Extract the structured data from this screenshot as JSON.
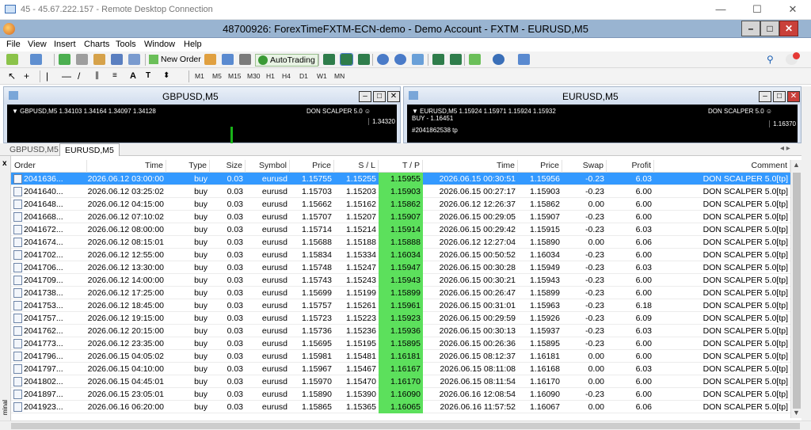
{
  "rdp": {
    "title": "45 - 45.67.222.157 - Remote Desktop Connection",
    "min": "—",
    "max": "☐",
    "close": "✕"
  },
  "app": {
    "title": "48700926: ForexTimeFXTM-ECN-demo - Demo Account - FXTM - EURUSD,M5"
  },
  "menu": [
    "File",
    "View",
    "Insert",
    "Charts",
    "Tools",
    "Window",
    "Help"
  ],
  "toolbar": {
    "new_order": "New Order",
    "auto_trading": "AutoTrading"
  },
  "timeframes": [
    "M1",
    "M5",
    "M15",
    "M30",
    "H1",
    "H4",
    "D1",
    "W1",
    "MN"
  ],
  "charts": [
    {
      "name": "GBPUSD,M5",
      "info": "GBPUSD,M5  1.34103 1.34164 1.34097 1.34128",
      "ea": "DON SCALPER 5.0",
      "price": "1.34320",
      "extra": "",
      "note": ""
    },
    {
      "name": "EURUSD,M5",
      "info": "EURUSD,M5  1.15924 1.15971 1.15924 1.15932",
      "ea": "DON SCALPER 5.0",
      "price": "1.16370",
      "extra": "BUY - 1.16451",
      "note": "#2041862538 tp"
    }
  ],
  "chart_tabs": [
    "GBPUSD,M5",
    "EURUSD,M5"
  ],
  "terminal": {
    "label": "minal",
    "close": "x",
    "columns": [
      "Order",
      "Time",
      "Type",
      "Size",
      "Symbol",
      "Price",
      "S / L",
      "T / P",
      "Time",
      "Price",
      "Swap",
      "Profit",
      "Comment"
    ],
    "rows": [
      [
        "2041636...",
        "2026.06.12 03:00:00",
        "buy",
        "0.03",
        "eurusd",
        "1.15755",
        "1.15255",
        "1.15955",
        "2026.06.15 00:30:51",
        "1.15956",
        "-0.23",
        "6.03",
        "DON SCALPER 5.0[tp]"
      ],
      [
        "2041640...",
        "2026.06.12 03:25:02",
        "buy",
        "0.03",
        "eurusd",
        "1.15703",
        "1.15203",
        "1.15903",
        "2026.06.15 00:27:17",
        "1.15903",
        "-0.23",
        "6.00",
        "DON SCALPER 5.0[tp]"
      ],
      [
        "2041648...",
        "2026.06.12 04:15:00",
        "buy",
        "0.03",
        "eurusd",
        "1.15662",
        "1.15162",
        "1.15862",
        "2026.06.12 12:26:37",
        "1.15862",
        "0.00",
        "6.00",
        "DON SCALPER 5.0[tp]"
      ],
      [
        "2041668...",
        "2026.06.12 07:10:02",
        "buy",
        "0.03",
        "eurusd",
        "1.15707",
        "1.15207",
        "1.15907",
        "2026.06.15 00:29:05",
        "1.15907",
        "-0.23",
        "6.00",
        "DON SCALPER 5.0[tp]"
      ],
      [
        "2041672...",
        "2026.06.12 08:00:00",
        "buy",
        "0.03",
        "eurusd",
        "1.15714",
        "1.15214",
        "1.15914",
        "2026.06.15 00:29:42",
        "1.15915",
        "-0.23",
        "6.03",
        "DON SCALPER 5.0[tp]"
      ],
      [
        "2041674...",
        "2026.06.12 08:15:01",
        "buy",
        "0.03",
        "eurusd",
        "1.15688",
        "1.15188",
        "1.15888",
        "2026.06.12 12:27:04",
        "1.15890",
        "0.00",
        "6.06",
        "DON SCALPER 5.0[tp]"
      ],
      [
        "2041702...",
        "2026.06.12 12:55:00",
        "buy",
        "0.03",
        "eurusd",
        "1.15834",
        "1.15334",
        "1.16034",
        "2026.06.15 00:50:52",
        "1.16034",
        "-0.23",
        "6.00",
        "DON SCALPER 5.0[tp]"
      ],
      [
        "2041706...",
        "2026.06.12 13:30:00",
        "buy",
        "0.03",
        "eurusd",
        "1.15748",
        "1.15247",
        "1.15947",
        "2026.06.15 00:30:28",
        "1.15949",
        "-0.23",
        "6.03",
        "DON SCALPER 5.0[tp]"
      ],
      [
        "2041709...",
        "2026.06.12 14:00:00",
        "buy",
        "0.03",
        "eurusd",
        "1.15743",
        "1.15243",
        "1.15943",
        "2026.06.15 00:30:21",
        "1.15943",
        "-0.23",
        "6.00",
        "DON SCALPER 5.0[tp]"
      ],
      [
        "2041738...",
        "2026.06.12 17:25:00",
        "buy",
        "0.03",
        "eurusd",
        "1.15699",
        "1.15199",
        "1.15899",
        "2026.06.15 00:26:47",
        "1.15899",
        "-0.23",
        "6.00",
        "DON SCALPER 5.0[tp]"
      ],
      [
        "2041753...",
        "2026.06.12 18:45:00",
        "buy",
        "0.03",
        "eurusd",
        "1.15757",
        "1.15261",
        "1.15961",
        "2026.06.15 00:31:01",
        "1.15963",
        "-0.23",
        "6.18",
        "DON SCALPER 5.0[tp]"
      ],
      [
        "2041757...",
        "2026.06.12 19:15:00",
        "buy",
        "0.03",
        "eurusd",
        "1.15723",
        "1.15223",
        "1.15923",
        "2026.06.15 00:29:59",
        "1.15926",
        "-0.23",
        "6.09",
        "DON SCALPER 5.0[tp]"
      ],
      [
        "2041762...",
        "2026.06.12 20:15:00",
        "buy",
        "0.03",
        "eurusd",
        "1.15736",
        "1.15236",
        "1.15936",
        "2026.06.15 00:30:13",
        "1.15937",
        "-0.23",
        "6.03",
        "DON SCALPER 5.0[tp]"
      ],
      [
        "2041773...",
        "2026.06.12 23:35:00",
        "buy",
        "0.03",
        "eurusd",
        "1.15695",
        "1.15195",
        "1.15895",
        "2026.06.15 00:26:36",
        "1.15895",
        "-0.23",
        "6.00",
        "DON SCALPER 5.0[tp]"
      ],
      [
        "2041796...",
        "2026.06.15 04:05:02",
        "buy",
        "0.03",
        "eurusd",
        "1.15981",
        "1.15481",
        "1.16181",
        "2026.06.15 08:12:37",
        "1.16181",
        "0.00",
        "6.00",
        "DON SCALPER 5.0[tp]"
      ],
      [
        "2041797...",
        "2026.06.15 04:10:00",
        "buy",
        "0.03",
        "eurusd",
        "1.15967",
        "1.15467",
        "1.16167",
        "2026.06.15 08:11:08",
        "1.16168",
        "0.00",
        "6.03",
        "DON SCALPER 5.0[tp]"
      ],
      [
        "2041802...",
        "2026.06.15 04:45:01",
        "buy",
        "0.03",
        "eurusd",
        "1.15970",
        "1.15470",
        "1.16170",
        "2026.06.15 08:11:54",
        "1.16170",
        "0.00",
        "6.00",
        "DON SCALPER 5.0[tp]"
      ],
      [
        "2041897...",
        "2026.06.15 23:05:01",
        "buy",
        "0.03",
        "eurusd",
        "1.15890",
        "1.15390",
        "1.16090",
        "2026.06.16 12:08:54",
        "1.16090",
        "-0.23",
        "6.00",
        "DON SCALPER 5.0[tp]"
      ],
      [
        "2041923...",
        "2026.06.16 06:20:00",
        "buy",
        "0.03",
        "eurusd",
        "1.15865",
        "1.15365",
        "1.16065",
        "2026.06.16 11:57:52",
        "1.16067",
        "0.00",
        "6.06",
        "DON SCALPER 5.0[tp]"
      ]
    ]
  },
  "colors": {
    "selected_row": "#3399ff",
    "tp_highlight": "#5ce05c",
    "title_bar": "#99b4d1"
  },
  "icons": [
    "monitor-icon",
    "mt4-logo-icon",
    "search-icon",
    "notification-icon",
    "order-ticket-icon"
  ]
}
